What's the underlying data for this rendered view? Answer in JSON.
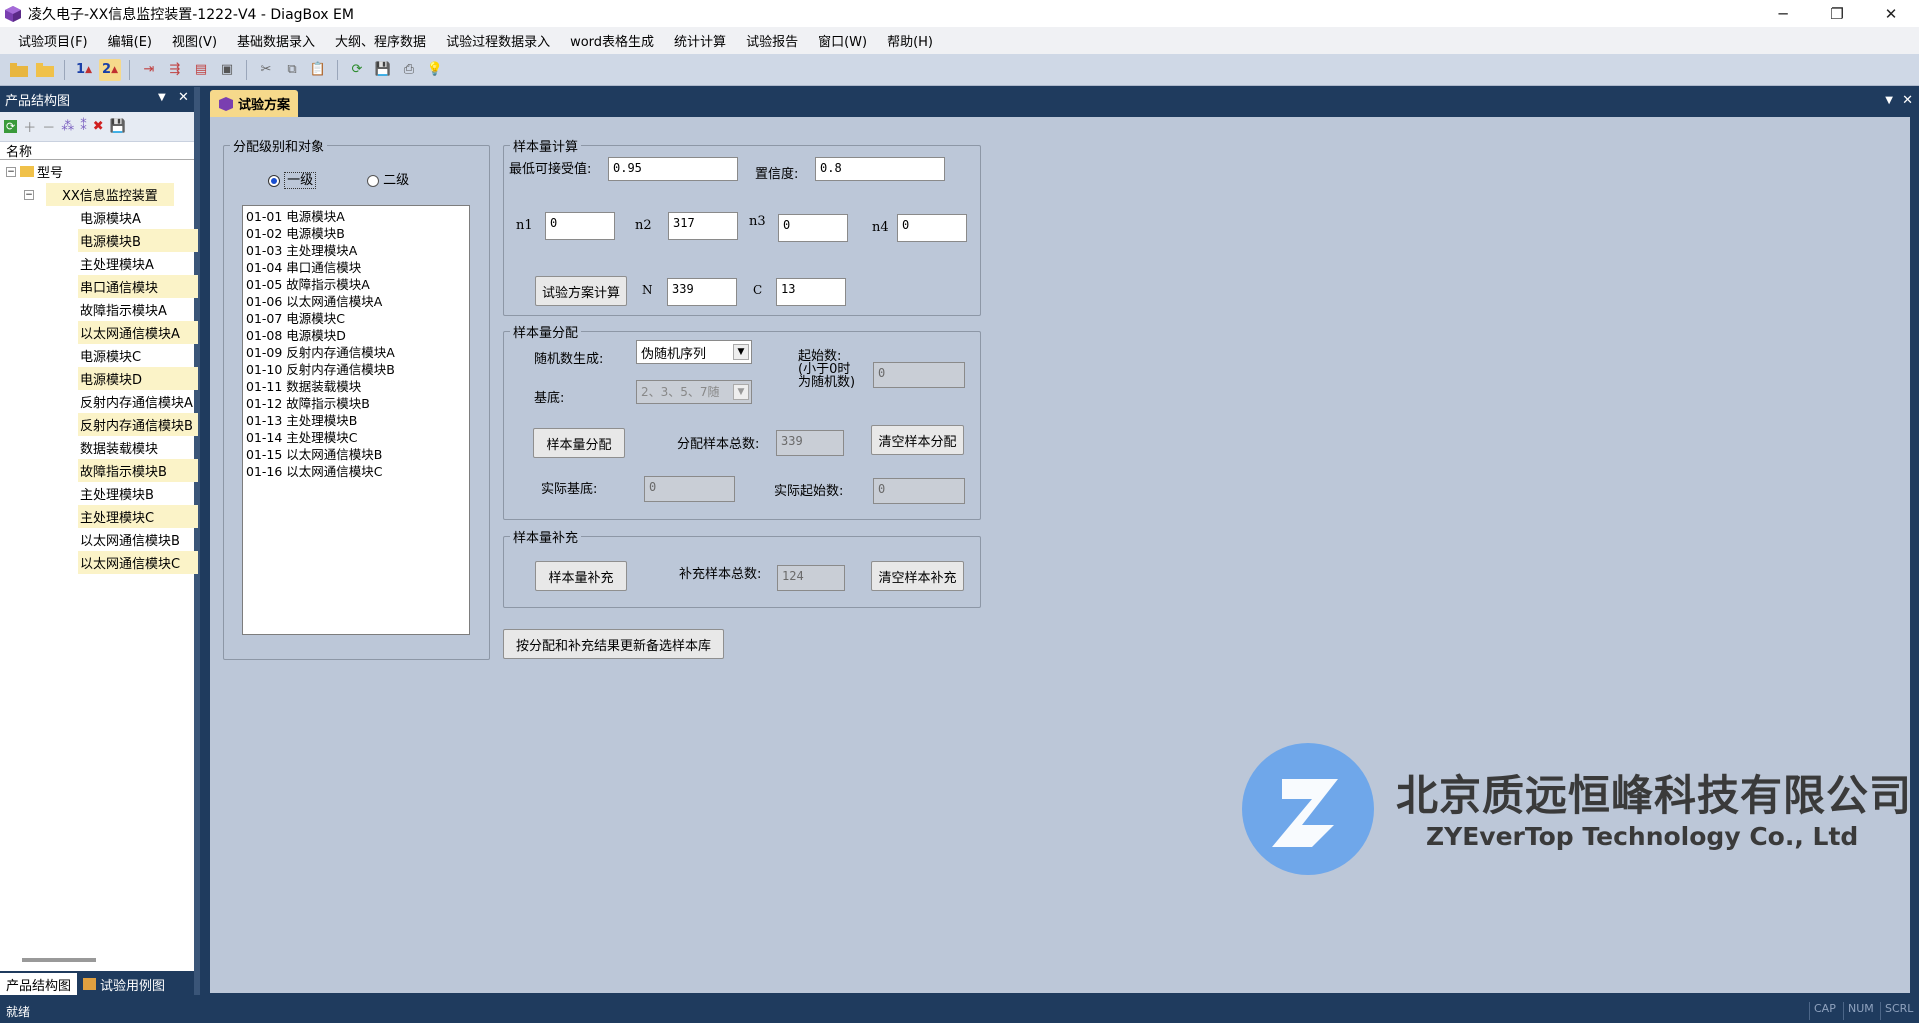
{
  "window": {
    "title": "凌久电子-XX信息监控装置-1222-V4 - DiagBox EM",
    "minimize": "─",
    "restore": "❐",
    "close": "✕"
  },
  "menu": [
    "试验项目(F)",
    "编辑(E)",
    "视图(V)",
    "基础数据录入",
    "大纲、程序数据",
    "试验过程数据录入",
    "word表格生成",
    "统计计算",
    "试验报告",
    "窗口(W)",
    "帮助(H)"
  ],
  "toolbar": {
    "level1": "1",
    "level2": "2"
  },
  "left_panel": {
    "title": "产品结构图",
    "column_header": "名称",
    "root": "型号",
    "device": "XX信息监控装置",
    "modules": [
      {
        "label": "电源模块A",
        "hl": false
      },
      {
        "label": "电源模块B",
        "hl": true
      },
      {
        "label": "主处理模块A",
        "hl": false
      },
      {
        "label": "串口通信模块",
        "hl": true
      },
      {
        "label": "故障指示模块A",
        "hl": false
      },
      {
        "label": "以太网通信模块A",
        "hl": true
      },
      {
        "label": "电源模块C",
        "hl": false
      },
      {
        "label": "电源模块D",
        "hl": true
      },
      {
        "label": "反射内存通信模块A",
        "hl": false
      },
      {
        "label": "反射内存通信模块B",
        "hl": true
      },
      {
        "label": "数据装载模块",
        "hl": false
      },
      {
        "label": "故障指示模块B",
        "hl": true
      },
      {
        "label": "主处理模块B",
        "hl": false
      },
      {
        "label": "主处理模块C",
        "hl": true
      },
      {
        "label": "以太网通信模块B",
        "hl": false
      },
      {
        "label": "以太网通信模块C",
        "hl": true
      }
    ],
    "tabs": [
      "产品结构图",
      "试验用例图"
    ]
  },
  "doc_tab": "试验方案",
  "level_group": {
    "legend": "分配级别和对象",
    "radio1": "一级",
    "radio2": "二级",
    "items": [
      "01-01 电源模块A",
      "01-02 电源模块B",
      "01-03 主处理模块A",
      "01-04 串口通信模块",
      "01-05 故障指示模块A",
      "01-06 以太网通信模块A",
      "01-07 电源模块C",
      "01-08 电源模块D",
      "01-09 反射内存通信模块A",
      "01-10 反射内存通信模块B",
      "01-11 数据装载模块",
      "01-12 故障指示模块B",
      "01-13 主处理模块B",
      "01-14 主处理模块C",
      "01-15 以太网通信模块B",
      "01-16 以太网通信模块C"
    ]
  },
  "sample_calc": {
    "legend": "样本量计算",
    "min_accept_label": "最低可接受值:",
    "min_accept": "0.95",
    "confidence_label": "置信度:",
    "confidence": "0.8",
    "n1_label": "n1",
    "n1": "0",
    "n2_label": "n2",
    "n2": "317",
    "n3_label": "n3",
    "n3": "0",
    "n4_label": "n4",
    "n4": "0",
    "calc_button": "试验方案计算",
    "N_label": "N",
    "N": "339",
    "C_label": "C",
    "C": "13"
  },
  "sample_alloc": {
    "legend": "样本量分配",
    "random_label": "随机数生成:",
    "random_value": "伪随机序列",
    "base_label": "基底:",
    "base_value": "2、3、5、7随",
    "start_label_1": "起始数:",
    "start_label_2": "(小于0时",
    "start_label_3": "为随机数)",
    "start_value": "0",
    "alloc_button": "样本量分配",
    "total_label": "分配样本总数:",
    "total_value": "339",
    "clear_button": "清空样本分配",
    "actual_base_label": "实际基底:",
    "actual_base": "0",
    "actual_start_label": "实际起始数:",
    "actual_start": "0"
  },
  "sample_supp": {
    "legend": "样本量补充",
    "supp_button": "样本量补充",
    "total_label": "补充样本总数:",
    "total_value": "124",
    "clear_button": "清空样本补充"
  },
  "update_button": "按分配和补充结果更新备选样本库",
  "watermark": {
    "cn": "北京质远恒峰科技有限公司",
    "en": "ZYEverTop Technology Co., Ltd"
  },
  "status": {
    "text": "就绪",
    "cap": "CAP",
    "num": "NUM",
    "scrl": "SCRL"
  },
  "colors": {
    "accent_tab": "#f6d98b",
    "frame": "#1f3b5e",
    "panel": "#bcc7d8",
    "logo": "#6fa7ea"
  }
}
